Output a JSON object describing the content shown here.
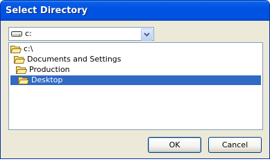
{
  "window": {
    "title": "Select Directory"
  },
  "drive": {
    "selected": "c:",
    "icon": "drive-icon"
  },
  "tree": {
    "items": [
      {
        "label": "c:\\",
        "icon": "folder-open-icon",
        "selected": false
      },
      {
        "label": "Documents and Settings",
        "icon": "folder-open-icon",
        "selected": false
      },
      {
        "label": "Production",
        "icon": "folder-open-icon",
        "selected": false
      },
      {
        "label": "Desktop",
        "icon": "folder-open-icon",
        "selected": true
      }
    ]
  },
  "buttons": {
    "ok": "OK",
    "cancel": "Cancel"
  },
  "colors": {
    "titlebar": "#0052e0",
    "selection": "#316ac5",
    "dialog_bg": "#ece9d8"
  }
}
